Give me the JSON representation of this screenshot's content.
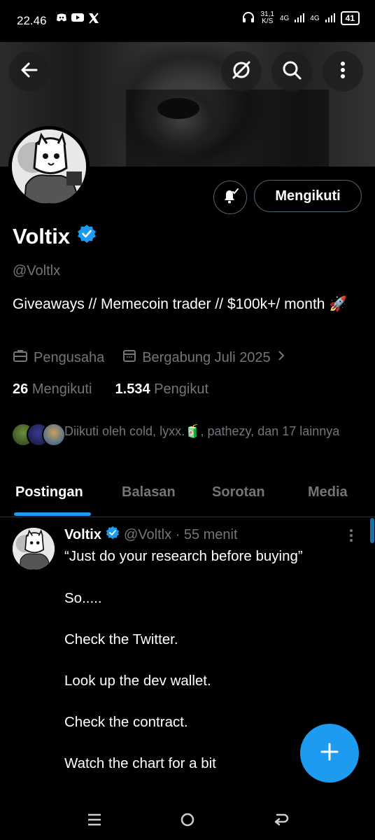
{
  "status_bar": {
    "time": "22.46",
    "net_speed_top": "31,1",
    "net_speed_unit": "K/S",
    "network_1": "4G",
    "network_2": "4G",
    "battery": "41"
  },
  "profile": {
    "name": "Voltix",
    "handle": "@Voltlx",
    "bio": "Giveaways // Memecoin trader // $100k+/ month 🚀",
    "occupation": "Pengusaha",
    "joined": "Bergabung Juli 2025",
    "following_count": "26",
    "following_label": "Mengikuti",
    "followers_count": "1.534",
    "followers_label": "Pengikut",
    "followed_by": "Diikuti oleh cold, lyxx.🧃, pathezy, dan 17 lainnya",
    "follow_button_label": "Mengikuti",
    "verified_color": "#1d9bf0"
  },
  "tabs": [
    "Postingan",
    "Balasan",
    "Sorotan",
    "Media"
  ],
  "post": {
    "name": "Voltix",
    "meta": "@Voltlx · 55 menit",
    "lines": [
      "“Just do your research before buying”",
      "So.....",
      "Check the Twitter.",
      "Look up the dev wallet.",
      "Check the contract.",
      "Watch the chart for a bit"
    ]
  },
  "icons": {
    "back": "back-arrow-icon",
    "grok": "grok-icon",
    "search": "search-icon",
    "more": "more-vertical-icon",
    "bell": "notification-bell-icon",
    "compose": "plus-icon"
  },
  "colors": {
    "accent": "#1d9bf0",
    "muted": "#71767b",
    "background": "#000000"
  }
}
